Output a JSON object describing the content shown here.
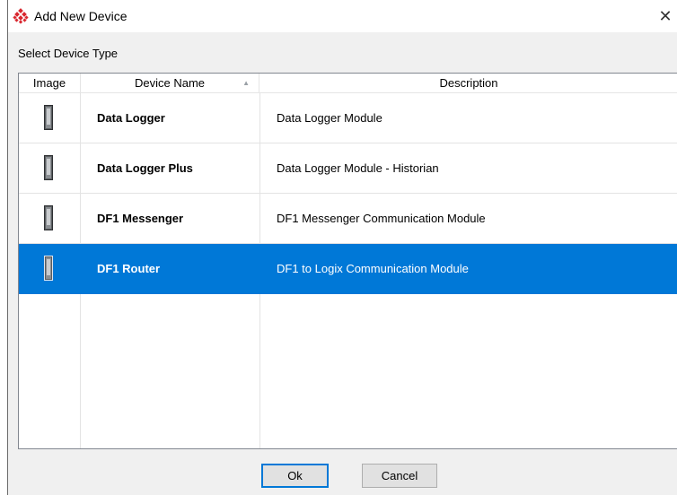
{
  "window": {
    "title": "Add New Device",
    "close_label": "✕"
  },
  "section_label": "Select Device Type",
  "table": {
    "columns": {
      "image": "Image",
      "name": "Device Name",
      "description": "Description"
    },
    "sort_indicator": "▲",
    "rows": [
      {
        "name": "Data Logger",
        "description": "Data Logger Module",
        "selected": false
      },
      {
        "name": "Data Logger Plus",
        "description": "Data Logger Module - Historian",
        "selected": false
      },
      {
        "name": "DF1 Messenger",
        "description": "DF1 Messenger Communication Module",
        "selected": false
      },
      {
        "name": "DF1 Router",
        "description": "DF1 to Logix Communication Module",
        "selected": true
      }
    ]
  },
  "buttons": {
    "ok": "Ok",
    "cancel": "Cancel"
  },
  "colors": {
    "selection": "#0078d7",
    "brand_icon": "#d9262e"
  }
}
